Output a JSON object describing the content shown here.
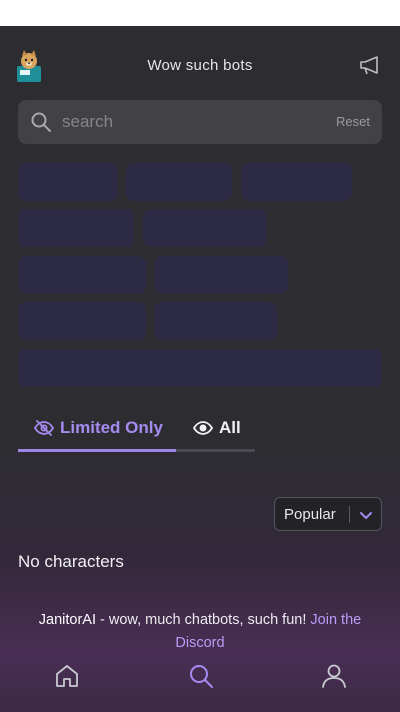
{
  "header": {
    "title": "Wow such bots",
    "avatar_icon": "doge-avatar",
    "announce_icon": "megaphone-icon"
  },
  "search": {
    "placeholder": "search",
    "reset_label": "Reset"
  },
  "tag_chip_count": 11,
  "tabs": [
    {
      "label": "Limited Only",
      "icon": "eye-slash-icon",
      "active": true
    },
    {
      "label": "All",
      "icon": "eye-icon",
      "active": false
    }
  ],
  "sort": {
    "selected": "Popular",
    "icon": "chevron-down-icon"
  },
  "empty_state": "No characters",
  "footer": {
    "brand": "JanitorAI",
    "text": " - wow, much chatbots, such fun! ",
    "link": "Join the Discord"
  },
  "nav": [
    {
      "name": "home",
      "icon": "home-icon"
    },
    {
      "name": "search",
      "icon": "search-icon",
      "active": true
    },
    {
      "name": "profile",
      "icon": "user-icon"
    }
  ],
  "colors": {
    "background": "#2d2d31",
    "accent": "#a58bf0",
    "chip": "#2c2a44",
    "search_bg": "#414146"
  }
}
